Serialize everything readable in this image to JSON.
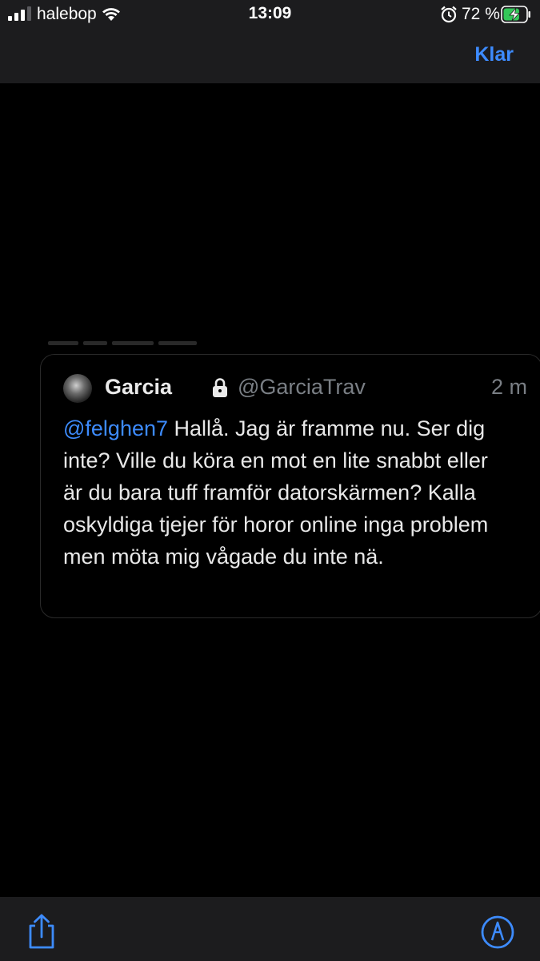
{
  "status_bar": {
    "carrier": "halebop",
    "time": "13:09",
    "battery_percent": "72 %",
    "battery_level": 0.72,
    "icons": [
      "signal-icon",
      "wifi-icon",
      "alarm-icon",
      "battery-charging-icon"
    ]
  },
  "nav": {
    "done_label": "Klar",
    "accent_color": "#3d8bfd"
  },
  "tweet": {
    "display_name": "Garcia",
    "handle": "@GarciaTrav",
    "timestamp": "2 m",
    "mention": "@felghen7",
    "text": " Hallå. Jag är framme nu. Ser dig inte? Ville du köra en mot en lite snabbt eller är du bara tuff framför datorskärmen? Kalla oskyldiga tjejer för horor online inga problem men möta mig vågade du inte nä.",
    "icons": [
      "avatar",
      "lock-icon"
    ]
  },
  "toolbar": {
    "icons": [
      "share-icon",
      "markup-icon"
    ]
  }
}
